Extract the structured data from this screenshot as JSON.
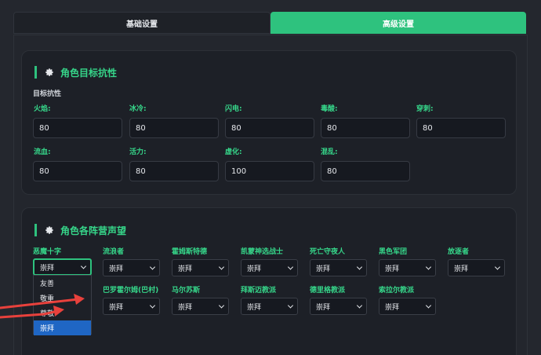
{
  "tabs": [
    {
      "label": "基础设置",
      "active": false
    },
    {
      "label": "高级设置",
      "active": true
    }
  ],
  "resistance": {
    "title": "角色目标抗性",
    "subtitle": "目标抗性",
    "fields": [
      {
        "label": "火焰:",
        "value": "80"
      },
      {
        "label": "冰冷:",
        "value": "80"
      },
      {
        "label": "闪电:",
        "value": "80"
      },
      {
        "label": "毒酸:",
        "value": "80"
      },
      {
        "label": "穿刺:",
        "value": "80"
      },
      {
        "label": "流血:",
        "value": "80"
      },
      {
        "label": "活力:",
        "value": "80"
      },
      {
        "label": "虚化:",
        "value": "100"
      },
      {
        "label": "混乱:",
        "value": "80"
      }
    ]
  },
  "reputation": {
    "title": "角色各阵营声望",
    "factions": [
      {
        "label": "恶魔十字",
        "value": "崇拜"
      },
      {
        "label": "流浪者",
        "value": "崇拜"
      },
      {
        "label": "霍姆斯特德",
        "value": "崇拜"
      },
      {
        "label": "凯蒙神选战士",
        "value": "崇拜"
      },
      {
        "label": "死亡守夜人",
        "value": "崇拜"
      },
      {
        "label": "黑色军团",
        "value": "崇拜"
      },
      {
        "label": "放逐者",
        "value": "崇拜"
      },
      {
        "label": "巴罗霍尔姆(巴村)",
        "value": "崇拜"
      },
      {
        "label": "马尔苏斯",
        "value": "崇拜"
      },
      {
        "label": "拜斯迈教派",
        "value": "崇拜"
      },
      {
        "label": "德里格教派",
        "value": "崇拜"
      },
      {
        "label": "索拉尔教派",
        "value": "崇拜"
      }
    ],
    "dropdown_options": [
      "友善",
      "敬重",
      "尊敬",
      "崇拜"
    ],
    "dropdown_selected": "崇拜"
  },
  "colors": {
    "accent": "#2ec27e",
    "annotation": "#e8413c",
    "selected_option": "#1f66c4"
  },
  "icons": {
    "section_icon": "gear-icon"
  }
}
